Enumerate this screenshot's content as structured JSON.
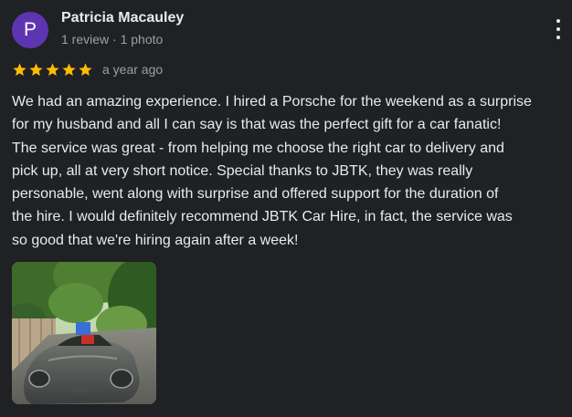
{
  "reviewer": {
    "initial": "P",
    "name": "Patricia Macauley",
    "meta": "1 review · 1 photo",
    "avatar_color": "#5e35b1"
  },
  "more_menu_icon": "more-vert-icon",
  "rating": {
    "stars": 5,
    "max": 5,
    "star_color": "#fbbc04",
    "date": "a year ago"
  },
  "review": {
    "text": "We had an amazing experience. I hired a Porsche for the weekend as a surprise\nfor my husband and all I can say is that was the perfect gift for a car fanatic!\nThe service was great - from helping me choose the right car to delivery and\npick up, all at very short notice. Special thanks to JBTK, they was really\npersonable, went along with surprise and offered support for the duration of\nthe hire. I would definitely recommend JBTK Car Hire, in fact, the service was\nso good that we're hiring again after a week!"
  },
  "photo": {
    "subject": "grey convertible car parked in a tree-lined driveway"
  },
  "colors": {
    "background": "#202124",
    "primary_text": "#e8eaed",
    "secondary_text": "#9aa0a6"
  }
}
